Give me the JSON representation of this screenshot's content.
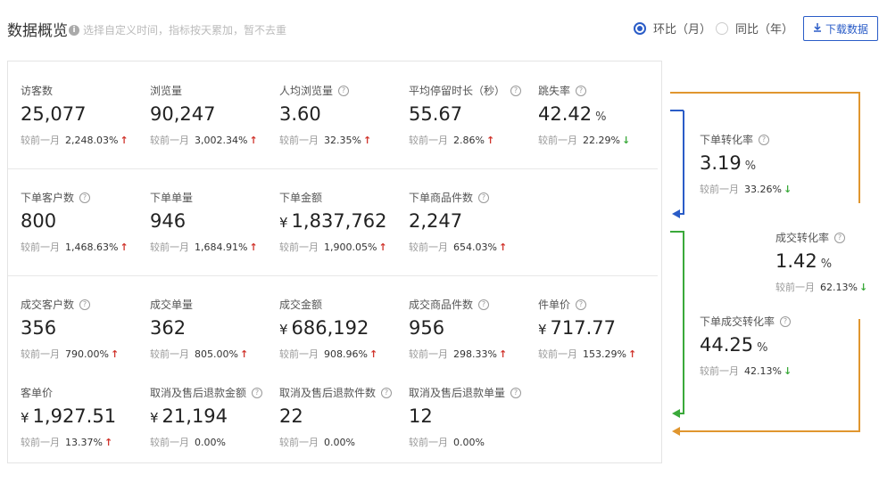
{
  "header": {
    "title": "数据概览",
    "hint": "选择自定义时间，指标按天累加，暂不去重",
    "radio_mom": "环比（月）",
    "radio_yoy": "同比（年）",
    "download": "下载数据"
  },
  "compare_label": "较前一月",
  "metrics": [
    {
      "label": "访客数",
      "value": "25,077",
      "unit": "",
      "cur": "",
      "pct": "2,248.03%",
      "trend": "up",
      "help": false
    },
    {
      "label": "浏览量",
      "value": "90,247",
      "unit": "",
      "cur": "",
      "pct": "3,002.34%",
      "trend": "up",
      "help": false
    },
    {
      "label": "人均浏览量",
      "value": "3.60",
      "unit": "",
      "cur": "",
      "pct": "32.35%",
      "trend": "up",
      "help": true
    },
    {
      "label": "平均停留时长（秒）",
      "value": "55.67",
      "unit": "",
      "cur": "",
      "pct": "2.86%",
      "trend": "up",
      "help": true
    },
    {
      "label": "跳失率",
      "value": "42.42",
      "unit": "%",
      "cur": "",
      "pct": "22.29%",
      "trend": "down",
      "help": true
    },
    {
      "label": "下单客户数",
      "value": "800",
      "unit": "",
      "cur": "",
      "pct": "1,468.63%",
      "trend": "up",
      "help": true
    },
    {
      "label": "下单单量",
      "value": "946",
      "unit": "",
      "cur": "",
      "pct": "1,684.91%",
      "trend": "up",
      "help": false
    },
    {
      "label": "下单金额",
      "value": "1,837,762",
      "unit": "",
      "cur": "¥",
      "pct": "1,900.05%",
      "trend": "up",
      "help": false
    },
    {
      "label": "下单商品件数",
      "value": "2,247",
      "unit": "",
      "cur": "",
      "pct": "654.03%",
      "trend": "up",
      "help": true
    },
    {
      "label": "成交客户数",
      "value": "356",
      "unit": "",
      "cur": "",
      "pct": "790.00%",
      "trend": "up",
      "help": true
    },
    {
      "label": "成交单量",
      "value": "362",
      "unit": "",
      "cur": "",
      "pct": "805.00%",
      "trend": "up",
      "help": false
    },
    {
      "label": "成交金额",
      "value": "686,192",
      "unit": "",
      "cur": "¥",
      "pct": "908.96%",
      "trend": "up",
      "help": false
    },
    {
      "label": "成交商品件数",
      "value": "956",
      "unit": "",
      "cur": "",
      "pct": "298.33%",
      "trend": "up",
      "help": true
    },
    {
      "label": "件单价",
      "value": "717.77",
      "unit": "",
      "cur": "¥",
      "pct": "153.29%",
      "trend": "up",
      "help": true
    },
    {
      "label": "客单价",
      "value": "1,927.51",
      "unit": "",
      "cur": "¥",
      "pct": "13.37%",
      "trend": "up",
      "help": false
    },
    {
      "label": "取消及售后退款金额",
      "value": "21,194",
      "unit": "",
      "cur": "¥",
      "pct": "0.00%",
      "trend": "none",
      "help": true
    },
    {
      "label": "取消及售后退款件数",
      "value": "22",
      "unit": "",
      "cur": "",
      "pct": "0.00%",
      "trend": "none",
      "help": true
    },
    {
      "label": "取消及售后退款单量",
      "value": "12",
      "unit": "",
      "cur": "",
      "pct": "0.00%",
      "trend": "none",
      "help": true
    }
  ],
  "conversions": [
    {
      "label": "下单转化率",
      "value": "3.19",
      "unit": "%",
      "pct": "33.26%",
      "trend": "down"
    },
    {
      "label": "成交转化率",
      "value": "1.42",
      "unit": "%",
      "pct": "62.13%",
      "trend": "down"
    },
    {
      "label": "下单成交转化率",
      "value": "44.25",
      "unit": "%",
      "pct": "42.13%",
      "trend": "down"
    }
  ],
  "colors": {
    "accent": "#2a5cc7",
    "up": "#d0342c",
    "down": "#3aa93a",
    "flow_blue": "#2a5cc7",
    "flow_green": "#3aa93a",
    "flow_orange": "#e0962f"
  }
}
